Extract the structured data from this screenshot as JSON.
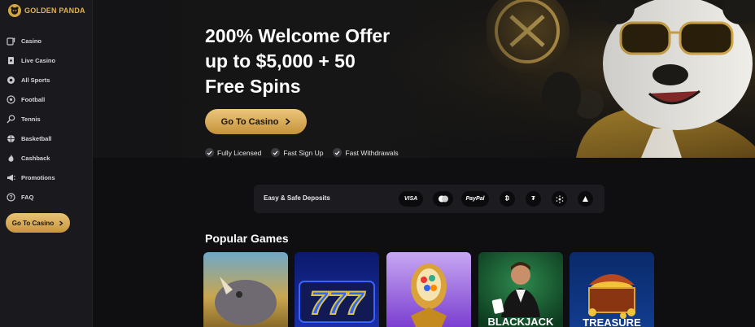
{
  "brand": {
    "name": "GOLDEN PANDA",
    "logo_color": "#d6a73f"
  },
  "sidebar": {
    "items": [
      {
        "label": "Casino",
        "icon": "slot-machine-icon"
      },
      {
        "label": "Live Casino",
        "icon": "cards-icon"
      },
      {
        "label": "All Sports",
        "icon": "ball-icon"
      },
      {
        "label": "Football",
        "icon": "football-icon"
      },
      {
        "label": "Tennis",
        "icon": "tennis-icon"
      },
      {
        "label": "Basketball",
        "icon": "basketball-icon"
      },
      {
        "label": "Cashback",
        "icon": "flame-icon"
      },
      {
        "label": "Promotions",
        "icon": "megaphone-icon"
      },
      {
        "label": "FAQ",
        "icon": "question-icon"
      }
    ],
    "cta_label": "Go To Casino"
  },
  "hero": {
    "title_line1": "200% Welcome Offer",
    "title_line2": "up to $5,000 + 50",
    "title_line3": "Free Spins",
    "cta_label": "Go To Casino",
    "features": [
      "Fully Licensed",
      "Fast Sign Up",
      "Fast Withdrawals"
    ]
  },
  "deposits": {
    "label": "Easy & Safe Deposits",
    "methods": [
      {
        "label": "VISA",
        "icon": "visa-icon"
      },
      {
        "label": "",
        "icon": "mastercard-icon"
      },
      {
        "label": "PayPal",
        "icon": "paypal-icon"
      },
      {
        "label": "",
        "icon": "bitcoin-icon"
      },
      {
        "label": "",
        "icon": "tether-icon"
      },
      {
        "label": "",
        "icon": "cardano-icon"
      },
      {
        "label": "",
        "icon": "tron-icon"
      }
    ]
  },
  "games": {
    "title": "Popular Games",
    "items": [
      {
        "label": "",
        "art": "rhino-icon"
      },
      {
        "label": "777",
        "art": "sevens-icon"
      },
      {
        "label": "",
        "art": "egg-icon"
      },
      {
        "label": "BLACKJACK",
        "art": "dealer-icon"
      },
      {
        "label": "TREASURE",
        "art": "treasure-chest-icon"
      }
    ]
  },
  "colors": {
    "accent": "#d9aa55",
    "background": "#0f0f12",
    "sidebar": "#1a1a1e"
  }
}
